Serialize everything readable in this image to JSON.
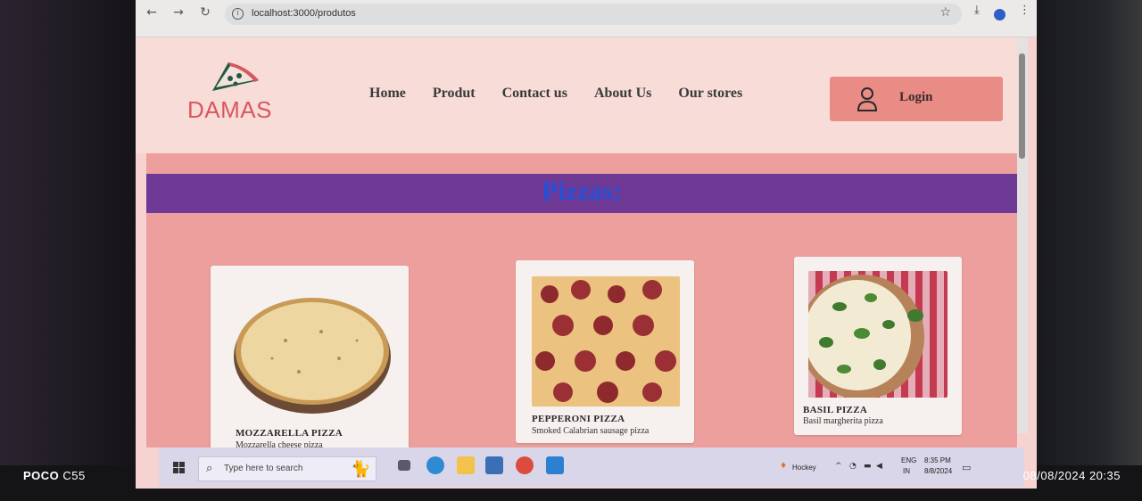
{
  "browser": {
    "url": "localhost:3000/produtos"
  },
  "site": {
    "logo_text": "DAMAS",
    "nav": [
      "Home",
      "Produt",
      "Contact us",
      "About Us",
      "Our stores"
    ],
    "login_label": "Login",
    "section_title": "Pizzas:"
  },
  "products": [
    {
      "title": "MOZZARELLA PIZZA",
      "desc": "Mozzarella cheese pizza",
      "stars": "★★★★★"
    },
    {
      "title": "PEPPERONI PIZZA",
      "desc": "Smoked Calabrian sausage pizza",
      "stars": "★★★★★"
    },
    {
      "title": "BASIL PIZZA",
      "desc": "Basil margherita pizza",
      "stars": "★★★★★"
    }
  ],
  "taskbar": {
    "search_placeholder": "Type here to search",
    "weather_label": "Hockey",
    "lang_top": "ENG",
    "lang_bottom": "IN",
    "clock_time": "8:35 PM",
    "clock_date": "8/8/2024"
  },
  "photo_overlay": {
    "brand_bold": "POCO",
    "brand_model": "C55",
    "timestamp": "08/08/2024  20:35"
  },
  "colors": {
    "header_bg": "#f8dcd8",
    "content_bg": "#ec9f9c",
    "band": "#6e3a96",
    "title": "#2450d8",
    "login_bg": "#ea8c86",
    "logo": "#d9575f"
  }
}
